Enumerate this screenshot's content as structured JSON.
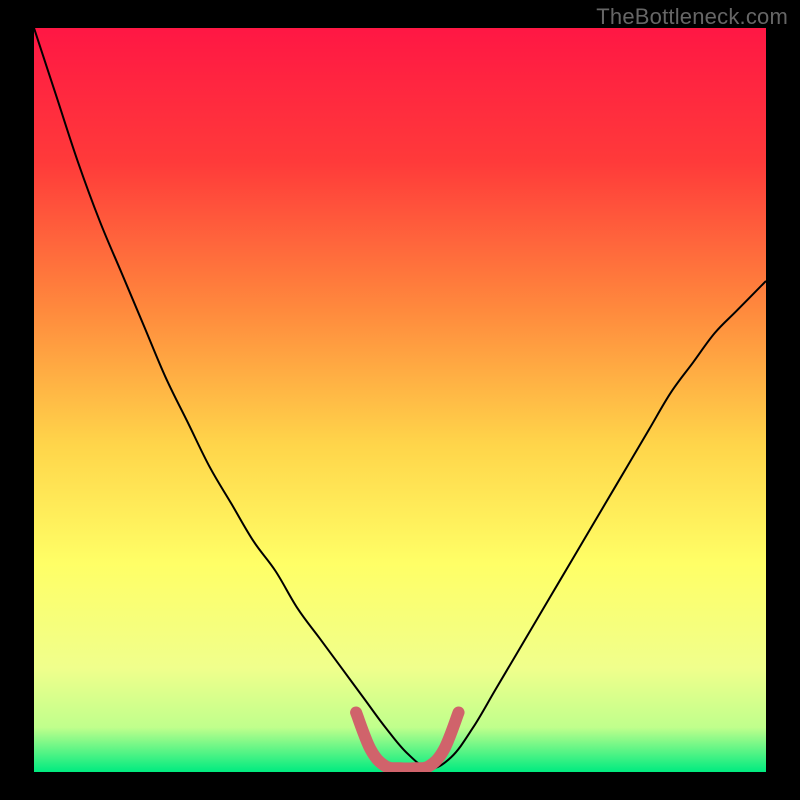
{
  "watermark": "TheBottleneck.com",
  "chart_data": {
    "type": "line",
    "title": "",
    "xlabel": "",
    "ylabel": "",
    "xlim": [
      0,
      100
    ],
    "ylim": [
      0,
      100
    ],
    "background": {
      "type": "vertical-gradient",
      "stops": [
        {
          "offset": 0,
          "color": "#ff1744"
        },
        {
          "offset": 18,
          "color": "#ff3a3a"
        },
        {
          "offset": 38,
          "color": "#ff8a3d"
        },
        {
          "offset": 56,
          "color": "#ffd54a"
        },
        {
          "offset": 72,
          "color": "#ffff66"
        },
        {
          "offset": 86,
          "color": "#f0ff8c"
        },
        {
          "offset": 94,
          "color": "#c0ff8c"
        },
        {
          "offset": 100,
          "color": "#00eb80"
        }
      ]
    },
    "series": [
      {
        "name": "bottleneck-curve",
        "color": "#000000",
        "x": [
          0,
          3,
          6,
          9,
          12,
          15,
          18,
          21,
          24,
          27,
          30,
          33,
          36,
          39,
          42,
          45,
          48,
          51,
          54,
          57,
          60,
          63,
          66,
          69,
          72,
          75,
          78,
          81,
          84,
          87,
          90,
          93,
          96,
          100
        ],
        "y": [
          100,
          91,
          82,
          74,
          67,
          60,
          53,
          47,
          41,
          36,
          31,
          27,
          22,
          18,
          14,
          10,
          6,
          2.5,
          0.5,
          2,
          6,
          11,
          16,
          21,
          26,
          31,
          36,
          41,
          46,
          51,
          55,
          59,
          62,
          66
        ]
      },
      {
        "name": "near-zero-highlight",
        "color": "#d0636b",
        "x": [
          44,
          46,
          48,
          50,
          52,
          54,
          56,
          58
        ],
        "y": [
          8,
          3,
          0.8,
          0.5,
          0.5,
          0.8,
          3,
          8
        ]
      }
    ]
  }
}
